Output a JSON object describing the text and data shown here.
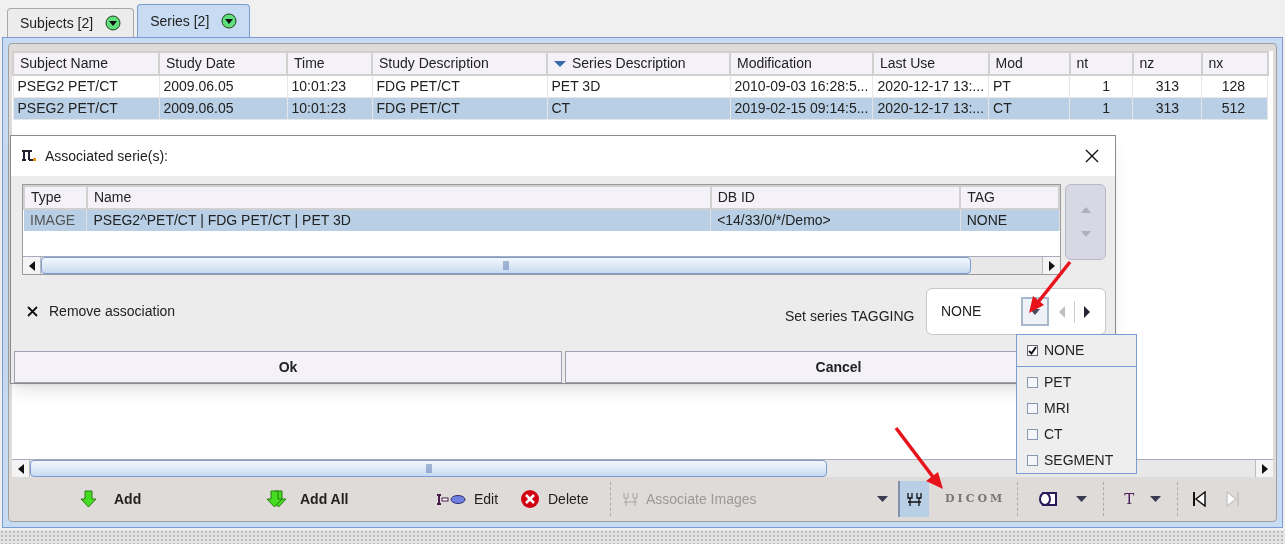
{
  "tabs": [
    {
      "label": "Subjects [2]",
      "selected": false
    },
    {
      "label": "Series [2]",
      "selected": true
    }
  ],
  "table": {
    "columns": [
      {
        "label": "Subject Name",
        "sorted": false
      },
      {
        "label": "Study Date",
        "sorted": false
      },
      {
        "label": "Time",
        "sorted": false
      },
      {
        "label": "Study Description",
        "sorted": false
      },
      {
        "label": "Series Description",
        "sorted": true
      },
      {
        "label": "Modification",
        "sorted": false
      },
      {
        "label": "Last Use",
        "sorted": false
      },
      {
        "label": "Mod",
        "sorted": false
      },
      {
        "label": "nt",
        "sorted": false
      },
      {
        "label": "nz",
        "sorted": false
      },
      {
        "label": "nx",
        "sorted": false
      }
    ],
    "rows": [
      {
        "selected": false,
        "cells": [
          "PSEG2 PET/CT",
          "2009.06.05",
          "10:01:23",
          "FDG PET/CT",
          "PET 3D",
          "2010-09-03 16:28:5...",
          "2020-12-17 13:...",
          "PT",
          "1",
          "313",
          "128"
        ]
      },
      {
        "selected": true,
        "cells": [
          "PSEG2 PET/CT",
          "2009.06.05",
          "10:01:23",
          "FDG PET/CT",
          "CT",
          "2019-02-15 09:14:5...",
          "2020-12-17 13:...",
          "CT",
          "1",
          "313",
          "512"
        ]
      }
    ]
  },
  "dialog": {
    "title": "Associated serie(s):",
    "table": {
      "columns": [
        "Type",
        "Name",
        "DB ID",
        "TAG"
      ],
      "rows": [
        {
          "selected": true,
          "cells": [
            "IMAGE",
            "PSEG2^PET/CT | FDG PET/CT | PET 3D",
            "<14/33/0/*/Demo>",
            "NONE"
          ]
        }
      ]
    },
    "remove_label": "Remove association",
    "tagging_label": "Set series TAGGING",
    "tagging_value": "NONE",
    "buttons": [
      "Ok",
      "Cancel"
    ]
  },
  "tag_menu": [
    {
      "label": "NONE",
      "checked": true
    },
    {
      "label": "PET",
      "checked": false
    },
    {
      "label": "MRI",
      "checked": false
    },
    {
      "label": "CT",
      "checked": false
    },
    {
      "label": "SEGMENT",
      "checked": false
    }
  ],
  "toolbar": [
    {
      "kind": "add",
      "label": "Add"
    },
    {
      "kind": "add_all",
      "label": "Add All"
    },
    {
      "kind": "edit",
      "label": "Edit"
    },
    {
      "kind": "delete",
      "label": "Delete"
    },
    {
      "kind": "separator"
    },
    {
      "kind": "associate",
      "label": "Associate Images",
      "disabled": true
    },
    {
      "kind": "caret"
    },
    {
      "kind": "toggle",
      "selected": true
    },
    {
      "kind": "dicom",
      "label": "DICOM"
    },
    {
      "kind": "separator"
    },
    {
      "kind": "cube"
    },
    {
      "kind": "caret"
    },
    {
      "kind": "separator"
    },
    {
      "kind": "text",
      "label": "T"
    },
    {
      "kind": "caret"
    },
    {
      "kind": "separator"
    },
    {
      "kind": "prev",
      "disabled": false
    },
    {
      "kind": "next",
      "disabled": true
    }
  ]
}
